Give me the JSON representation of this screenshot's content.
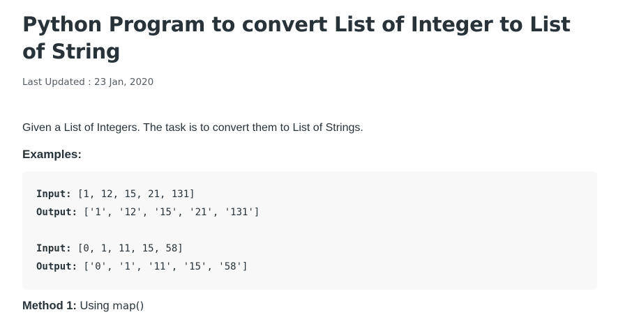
{
  "article": {
    "title": "Python Program to convert List of Integer to List of String",
    "last_updated": "Last Updated : 23 Jan, 2020",
    "intro": "Given a List of Integers. The task is to convert them to List of Strings.",
    "examples_heading": "Examples:",
    "examples": [
      {
        "input_label": "Input:",
        "input_value": " [1, 12, 15, 21, 131]",
        "output_label": "Output:",
        "output_value": " ['1', '12', '15', '21', '131']"
      },
      {
        "input_label": "Input:",
        "input_value": " [0, 1, 11, 15, 58]",
        "output_label": "Output:",
        "output_value": " ['0', '1', '11', '15', '58']"
      }
    ],
    "method": {
      "label": "Method 1:",
      "text": " Using ",
      "function": "map()"
    }
  }
}
